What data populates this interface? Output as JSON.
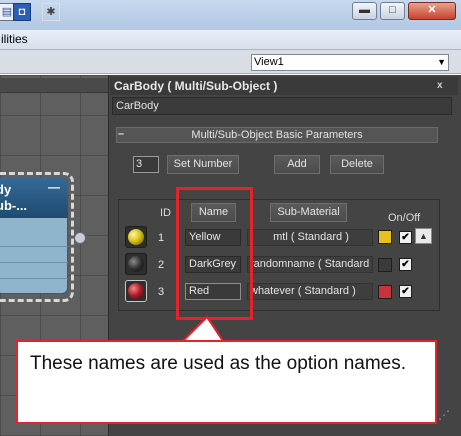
{
  "window": {
    "menu_fragment": "ilities",
    "min_label": "▬",
    "max_label": "□",
    "close_label": "✕"
  },
  "toolbar": {
    "viewport_select": "View1"
  },
  "node": {
    "title_line1": "dy",
    "title_line2": "ub-...",
    "collapse": "—"
  },
  "panel": {
    "title": "CarBody  ( Multi/Sub-Object )",
    "close": "x",
    "name_field": "CarBody",
    "rollout_toggle": "–",
    "rollout_title": "Multi/Sub-Object Basic Parameters",
    "num_materials": "3",
    "set_number": "Set Number",
    "add": "Add",
    "delete": "Delete",
    "headers": {
      "id": "ID",
      "name": "Name",
      "sub_material": "Sub-Material",
      "on_off": "On/Off"
    },
    "rows": [
      {
        "id": "1",
        "name": "Yellow",
        "material": "mtl  ( Standard )",
        "ball_color": "#d6c21a",
        "swatch": "#e5c21c",
        "on": "✔"
      },
      {
        "id": "2",
        "name": "DarkGrey",
        "material": "randomname  ( Standard )",
        "ball_color": "#3a3a3a",
        "swatch": "#3b3b3b",
        "on": "✔"
      },
      {
        "id": "3",
        "name": "Red",
        "material": "whatever  ( Standard )",
        "ball_color": "#b0202a",
        "swatch": "#c7343a",
        "on": "✔"
      }
    ],
    "scroll_up": "▲"
  },
  "annotation": {
    "callout_text": "These names are used as the option names.",
    "accent": "#e3242b"
  }
}
